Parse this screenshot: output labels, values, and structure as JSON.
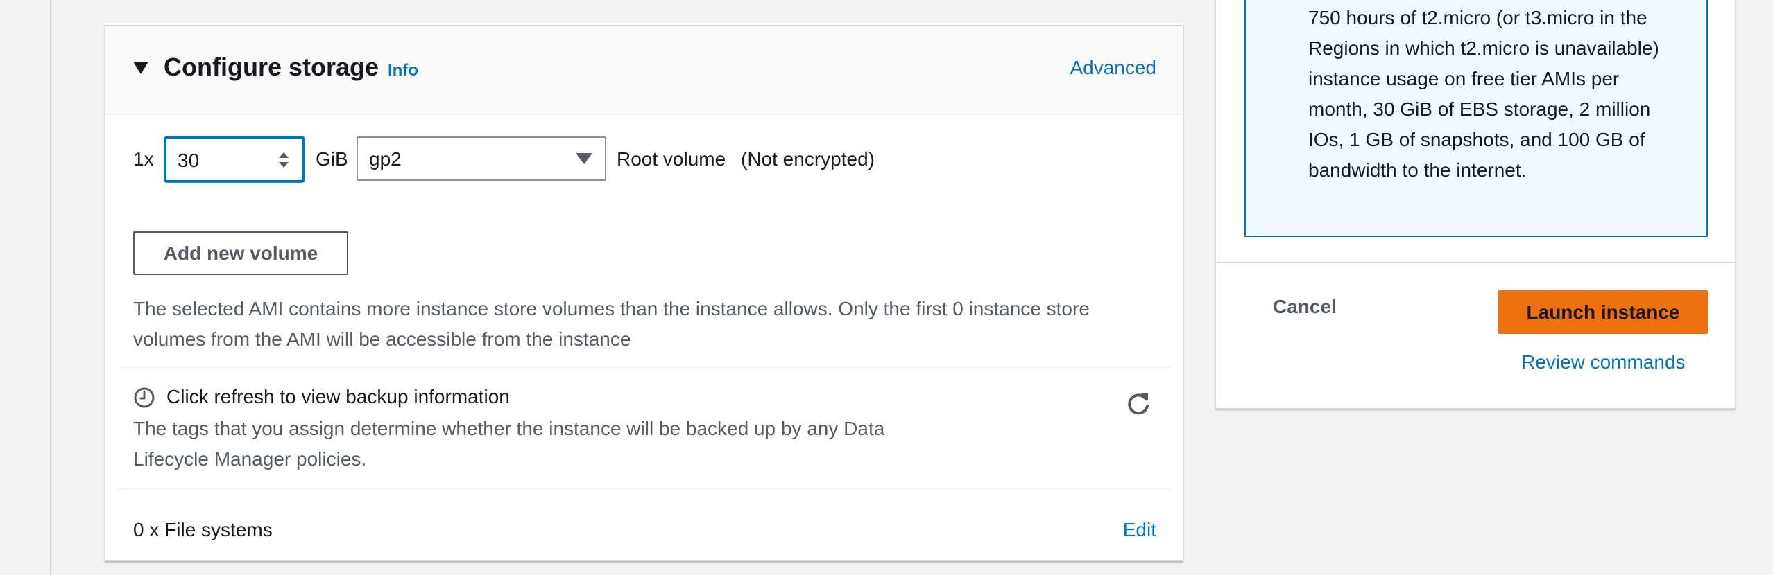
{
  "storage": {
    "title": "Configure storage",
    "info_label": "Info",
    "advanced_label": "Advanced",
    "volume": {
      "count_label": "1x",
      "size_value": "30",
      "unit_label": "GiB",
      "type_value": "gp2",
      "root_label": "Root volume",
      "encryption_label": "(Not encrypted)"
    },
    "add_volume_label": "Add new volume",
    "ami_warning": "The selected AMI contains more instance store volumes than the instance allows. Only the first 0 instance store volumes from the AMI will be accessible from the instance",
    "backup": {
      "title": "Click refresh to view backup information",
      "description": "The tags that you assign determine whether the instance will be backed up by any Data Lifecycle Manager policies."
    },
    "file_systems_label": "0 x File systems",
    "edit_label": "Edit"
  },
  "summary": {
    "free_tier_text": "750 hours of t2.micro (or t3.micro in the Regions in which t2.micro is unavailable) instance usage on free tier AMIs per month, 30 GiB of EBS storage, 2 million IOs, 1 GB of snapshots, and 100 GB of bandwidth to the internet.",
    "cancel_label": "Cancel",
    "launch_label": "Launch instance",
    "review_label": "Review commands"
  },
  "icons": {
    "caret": "caret-down-icon",
    "clock": "clock-icon",
    "refresh": "refresh-icon",
    "spinner": "spinner-icon",
    "select_arrow": "dropdown-arrow-icon"
  },
  "colors": {
    "link": "#0073bb",
    "primary_button": "#ec7211",
    "free_tier_bg": "#f1faff",
    "page_bg": "#f2f3f3"
  }
}
